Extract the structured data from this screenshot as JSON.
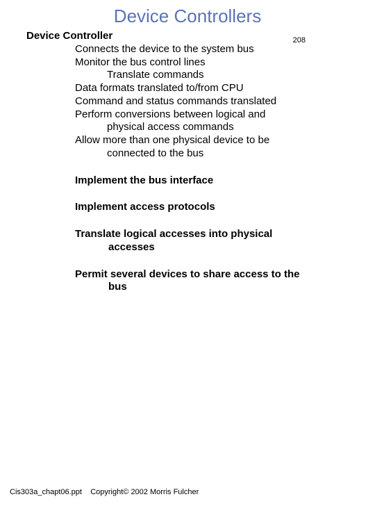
{
  "title": "Device Controllers",
  "page_number": "208",
  "heading": "Device Controller",
  "body": {
    "l1": "Connects the device to the system bus",
    "l2": "Monitor the bus control lines",
    "l3": "Translate commands",
    "l4": "Data formats translated to/from CPU",
    "l5": "Command and status commands translated",
    "l6": "Perform conversions between logical and",
    "l7": "physical access commands",
    "l8": "Allow more than one physical device to be",
    "l9": "connected to the bus"
  },
  "bold": {
    "b1": "Implement the bus interface",
    "b2": "Implement access protocols",
    "b3a": "Translate logical accesses into physical",
    "b3b": "accesses",
    "b4a": "Permit several devices to share access to the",
    "b4b": "bus"
  },
  "footer": {
    "file": "Cis303a_chapt06.ppt",
    "copy": "Copyright© 2002 Morris Fulcher"
  }
}
